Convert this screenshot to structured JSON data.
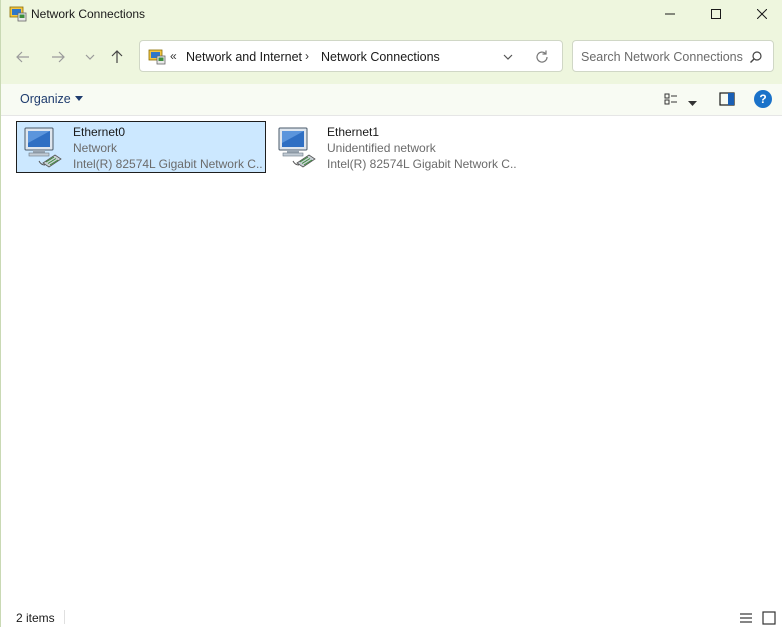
{
  "window": {
    "title": "Network Connections",
    "icon": "network-connections-icon"
  },
  "title_buttons": {
    "minimize_icon": "minimize-icon",
    "maximize_icon": "maximize-icon",
    "close_icon": "close-icon"
  },
  "nav": {
    "back_icon": "arrow-left-icon",
    "forward_icon": "arrow-right-icon",
    "recent_icon": "chevron-down-icon",
    "up_icon": "arrow-up-icon"
  },
  "address": {
    "overflow": "«",
    "crumbs": [
      "Network and Internet",
      "Network Connections"
    ],
    "separator": "›"
  },
  "search": {
    "placeholder": "Search Network Connections"
  },
  "command_bar": {
    "organize_label": "Organize"
  },
  "items": [
    {
      "name": "Ethernet0",
      "status": "Network",
      "adapter": "Intel(R) 82574L Gigabit Network C...",
      "selected": true
    },
    {
      "name": "Ethernet1",
      "status": "Unidentified network",
      "adapter": "Intel(R) 82574L Gigabit Network C...",
      "selected": false
    }
  ],
  "status_bar": {
    "count": "2 items"
  },
  "colors": {
    "chrome": "#eef6de",
    "selection": "#cce8ff",
    "help": "#1a72c9",
    "accent_text": "#1f3c6e"
  }
}
